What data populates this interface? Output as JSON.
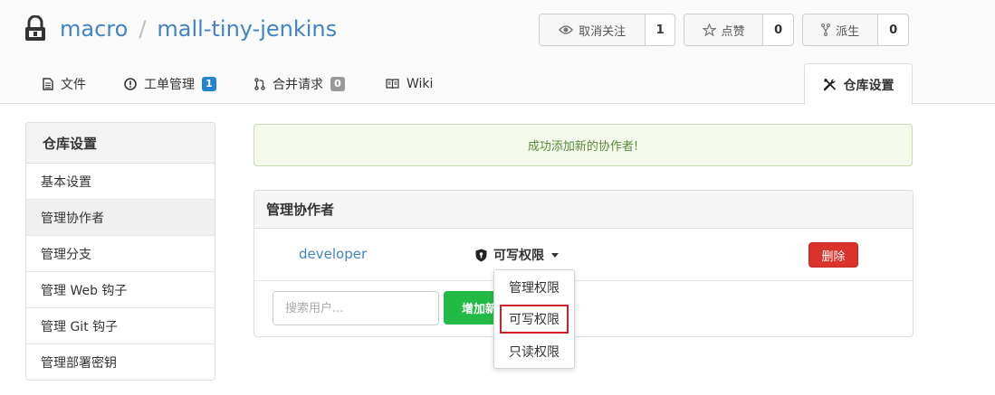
{
  "header": {
    "owner": "macro",
    "separator": "/",
    "repo": "mall-tiny-jenkins",
    "watch": {
      "label": "取消关注",
      "count": "1"
    },
    "star": {
      "label": "点赞",
      "count": "0"
    },
    "fork": {
      "label": "派生",
      "count": "0"
    }
  },
  "tabs": [
    {
      "label": "文件",
      "icon": "file-icon"
    },
    {
      "label": "工单管理",
      "icon": "issue-icon",
      "badge": "1",
      "badge_color": "#2185d0"
    },
    {
      "label": "合并请求",
      "icon": "pull-request-icon",
      "badge": "0",
      "badge_color": "#999999"
    },
    {
      "label": "Wiki",
      "icon": "book-icon"
    },
    {
      "label": "仓库设置",
      "icon": "tools-icon",
      "active": true
    }
  ],
  "sidebar": {
    "title": "仓库设置",
    "items": [
      {
        "label": "基本设置"
      },
      {
        "label": "管理协作者",
        "active": true
      },
      {
        "label": "管理分支"
      },
      {
        "label": "管理 Web 钩子"
      },
      {
        "label": "管理 Git 钩子"
      },
      {
        "label": "管理部署密钥"
      }
    ]
  },
  "alert": {
    "message": "成功添加新的协作者!",
    "color": "#5b8a3a"
  },
  "collaborators": {
    "title": "管理协作者",
    "rows": [
      {
        "name": "developer",
        "permission": "可写权限",
        "delete_label": "删除"
      }
    ],
    "search": {
      "placeholder": "搜索用户..."
    },
    "add_label": "增加新的协作者"
  },
  "permission_dropdown": {
    "options": [
      "管理权限",
      "可写权限",
      "只读权限"
    ],
    "highlighted": "可写权限",
    "highlight_color": "#d0202a"
  },
  "colors": {
    "link": "#4183c4",
    "danger": "#d9332c",
    "success": "#21ba45"
  }
}
